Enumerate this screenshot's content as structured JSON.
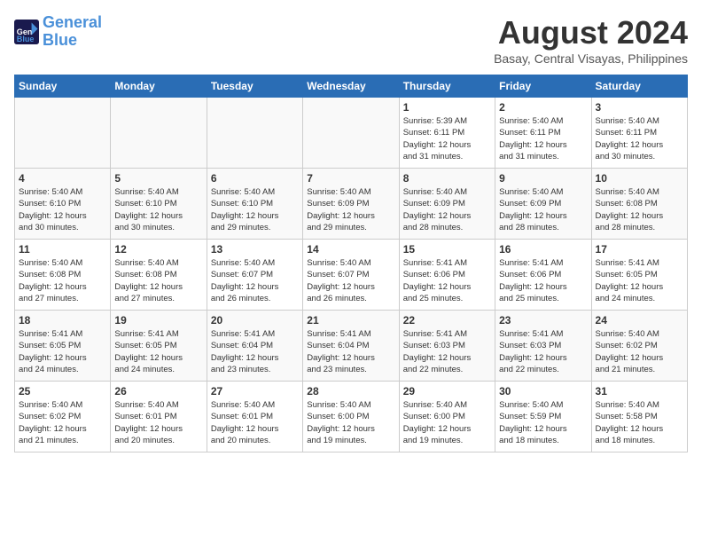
{
  "header": {
    "logo_line1": "General",
    "logo_line2": "Blue",
    "month_year": "August 2024",
    "location": "Basay, Central Visayas, Philippines"
  },
  "days_of_week": [
    "Sunday",
    "Monday",
    "Tuesday",
    "Wednesday",
    "Thursday",
    "Friday",
    "Saturday"
  ],
  "weeks": [
    [
      {
        "day": "",
        "info": "",
        "empty": true
      },
      {
        "day": "",
        "info": "",
        "empty": true
      },
      {
        "day": "",
        "info": "",
        "empty": true
      },
      {
        "day": "",
        "info": "",
        "empty": true
      },
      {
        "day": "1",
        "info": "Sunrise: 5:39 AM\nSunset: 6:11 PM\nDaylight: 12 hours\nand 31 minutes."
      },
      {
        "day": "2",
        "info": "Sunrise: 5:40 AM\nSunset: 6:11 PM\nDaylight: 12 hours\nand 31 minutes."
      },
      {
        "day": "3",
        "info": "Sunrise: 5:40 AM\nSunset: 6:11 PM\nDaylight: 12 hours\nand 30 minutes."
      }
    ],
    [
      {
        "day": "4",
        "info": "Sunrise: 5:40 AM\nSunset: 6:10 PM\nDaylight: 12 hours\nand 30 minutes."
      },
      {
        "day": "5",
        "info": "Sunrise: 5:40 AM\nSunset: 6:10 PM\nDaylight: 12 hours\nand 30 minutes."
      },
      {
        "day": "6",
        "info": "Sunrise: 5:40 AM\nSunset: 6:10 PM\nDaylight: 12 hours\nand 29 minutes."
      },
      {
        "day": "7",
        "info": "Sunrise: 5:40 AM\nSunset: 6:09 PM\nDaylight: 12 hours\nand 29 minutes."
      },
      {
        "day": "8",
        "info": "Sunrise: 5:40 AM\nSunset: 6:09 PM\nDaylight: 12 hours\nand 28 minutes."
      },
      {
        "day": "9",
        "info": "Sunrise: 5:40 AM\nSunset: 6:09 PM\nDaylight: 12 hours\nand 28 minutes."
      },
      {
        "day": "10",
        "info": "Sunrise: 5:40 AM\nSunset: 6:08 PM\nDaylight: 12 hours\nand 28 minutes."
      }
    ],
    [
      {
        "day": "11",
        "info": "Sunrise: 5:40 AM\nSunset: 6:08 PM\nDaylight: 12 hours\nand 27 minutes."
      },
      {
        "day": "12",
        "info": "Sunrise: 5:40 AM\nSunset: 6:08 PM\nDaylight: 12 hours\nand 27 minutes."
      },
      {
        "day": "13",
        "info": "Sunrise: 5:40 AM\nSunset: 6:07 PM\nDaylight: 12 hours\nand 26 minutes."
      },
      {
        "day": "14",
        "info": "Sunrise: 5:40 AM\nSunset: 6:07 PM\nDaylight: 12 hours\nand 26 minutes."
      },
      {
        "day": "15",
        "info": "Sunrise: 5:41 AM\nSunset: 6:06 PM\nDaylight: 12 hours\nand 25 minutes."
      },
      {
        "day": "16",
        "info": "Sunrise: 5:41 AM\nSunset: 6:06 PM\nDaylight: 12 hours\nand 25 minutes."
      },
      {
        "day": "17",
        "info": "Sunrise: 5:41 AM\nSunset: 6:05 PM\nDaylight: 12 hours\nand 24 minutes."
      }
    ],
    [
      {
        "day": "18",
        "info": "Sunrise: 5:41 AM\nSunset: 6:05 PM\nDaylight: 12 hours\nand 24 minutes."
      },
      {
        "day": "19",
        "info": "Sunrise: 5:41 AM\nSunset: 6:05 PM\nDaylight: 12 hours\nand 24 minutes."
      },
      {
        "day": "20",
        "info": "Sunrise: 5:41 AM\nSunset: 6:04 PM\nDaylight: 12 hours\nand 23 minutes."
      },
      {
        "day": "21",
        "info": "Sunrise: 5:41 AM\nSunset: 6:04 PM\nDaylight: 12 hours\nand 23 minutes."
      },
      {
        "day": "22",
        "info": "Sunrise: 5:41 AM\nSunset: 6:03 PM\nDaylight: 12 hours\nand 22 minutes."
      },
      {
        "day": "23",
        "info": "Sunrise: 5:41 AM\nSunset: 6:03 PM\nDaylight: 12 hours\nand 22 minutes."
      },
      {
        "day": "24",
        "info": "Sunrise: 5:40 AM\nSunset: 6:02 PM\nDaylight: 12 hours\nand 21 minutes."
      }
    ],
    [
      {
        "day": "25",
        "info": "Sunrise: 5:40 AM\nSunset: 6:02 PM\nDaylight: 12 hours\nand 21 minutes."
      },
      {
        "day": "26",
        "info": "Sunrise: 5:40 AM\nSunset: 6:01 PM\nDaylight: 12 hours\nand 20 minutes."
      },
      {
        "day": "27",
        "info": "Sunrise: 5:40 AM\nSunset: 6:01 PM\nDaylight: 12 hours\nand 20 minutes."
      },
      {
        "day": "28",
        "info": "Sunrise: 5:40 AM\nSunset: 6:00 PM\nDaylight: 12 hours\nand 19 minutes."
      },
      {
        "day": "29",
        "info": "Sunrise: 5:40 AM\nSunset: 6:00 PM\nDaylight: 12 hours\nand 19 minutes."
      },
      {
        "day": "30",
        "info": "Sunrise: 5:40 AM\nSunset: 5:59 PM\nDaylight: 12 hours\nand 18 minutes."
      },
      {
        "day": "31",
        "info": "Sunrise: 5:40 AM\nSunset: 5:58 PM\nDaylight: 12 hours\nand 18 minutes."
      }
    ]
  ]
}
